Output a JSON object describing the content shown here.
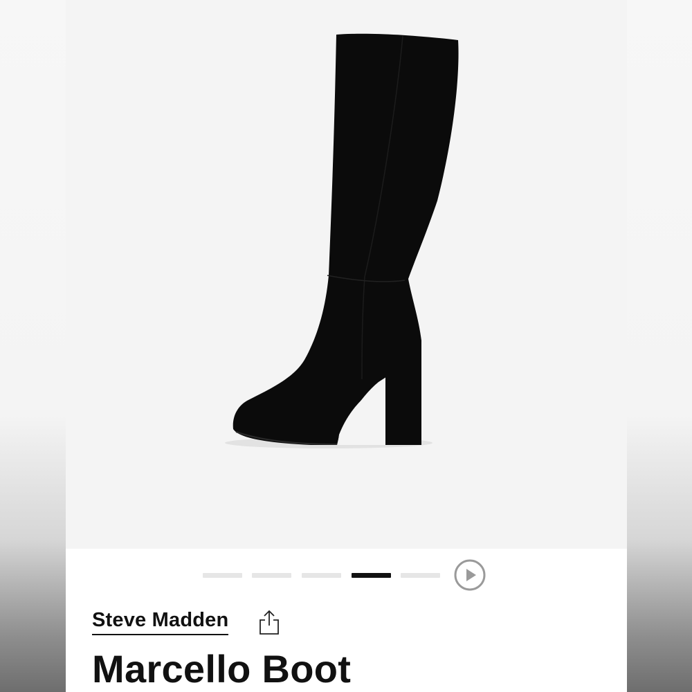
{
  "product": {
    "brand": "Steve Madden",
    "name": "Marcello Boot"
  },
  "gallery": {
    "slide_count": 5,
    "active_slide": 4,
    "has_video": true,
    "image_subject": "black suede knee-high platform boot",
    "indicator_color": "#111111",
    "inactive_color": "#e6e6e6"
  },
  "icons": {
    "play": "play-circle-icon",
    "share": "share-icon"
  }
}
